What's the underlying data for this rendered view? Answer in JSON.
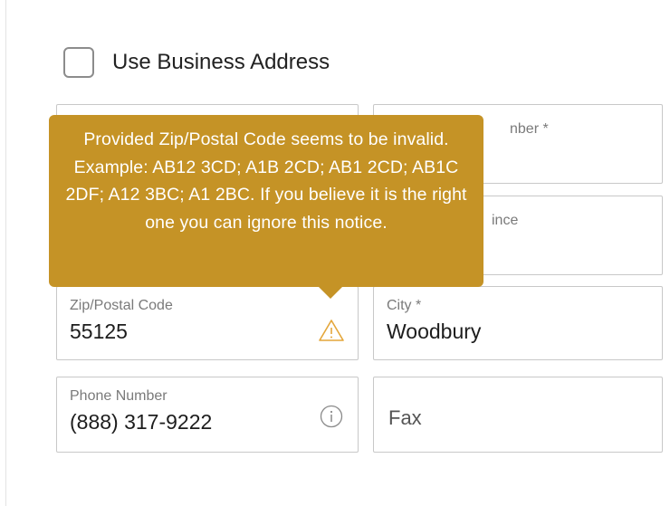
{
  "form": {
    "use_business_address_label": "Use Business Address",
    "fields": {
      "top_right_label_fragment": "nber *",
      "state_label_fragment": "ince",
      "zip": {
        "label": "Zip/Postal Code",
        "value": "55125"
      },
      "city": {
        "label": "City *",
        "value": "Woodbury"
      },
      "phone": {
        "label": "Phone Number",
        "value": "(888) 317-9222"
      },
      "fax": {
        "placeholder": "Fax"
      }
    }
  },
  "tooltip": {
    "text": "Provided Zip/Postal Code seems to be invalid. Example: AB12 3CD; A1B 2CD; AB1 2CD; AB1C 2DF; A12 3BC; A1 2BC. If you believe it is the right one you can ignore this notice."
  },
  "icons": {
    "warning": "warning-triangle-icon",
    "info": "info-circle-icon"
  },
  "colors": {
    "tooltip_bg": "#c59326",
    "warning": "#e4a63a"
  }
}
